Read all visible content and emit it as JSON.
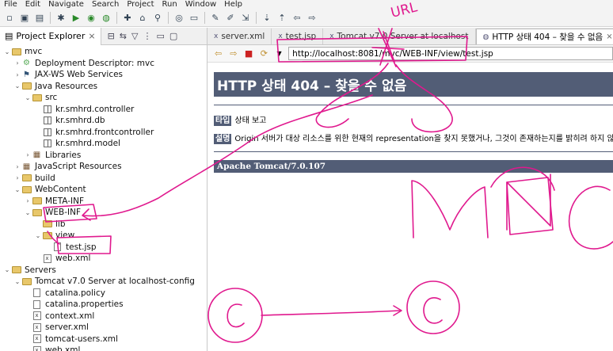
{
  "menu": [
    "File",
    "Edit",
    "Navigate",
    "Search",
    "Project",
    "Run",
    "Window",
    "Help"
  ],
  "explorer": {
    "title": "Project Explorer",
    "tree": [
      {
        "level": 0,
        "arrow": "open",
        "icon": "project",
        "label": "mvc"
      },
      {
        "level": 1,
        "arrow": "closed",
        "icon": "descriptor",
        "label": "Deployment Descriptor: mvc"
      },
      {
        "level": 1,
        "arrow": "closed",
        "icon": "webservice",
        "label": "JAX-WS Web Services"
      },
      {
        "level": 1,
        "arrow": "open",
        "icon": "java-resources",
        "label": "Java Resources"
      },
      {
        "level": 2,
        "arrow": "open",
        "icon": "src-folder",
        "label": "src"
      },
      {
        "level": 3,
        "arrow": "none",
        "icon": "package",
        "label": "kr.smhrd.controller"
      },
      {
        "level": 3,
        "arrow": "none",
        "icon": "package",
        "label": "kr.smhrd.db"
      },
      {
        "level": 3,
        "arrow": "none",
        "icon": "package",
        "label": "kr.smhrd.frontcontroller"
      },
      {
        "level": 3,
        "arrow": "none",
        "icon": "package",
        "label": "kr.smhrd.model"
      },
      {
        "level": 2,
        "arrow": "closed",
        "icon": "library",
        "label": "Libraries"
      },
      {
        "level": 1,
        "arrow": "closed",
        "icon": "js-resources",
        "label": "JavaScript Resources"
      },
      {
        "level": 1,
        "arrow": "closed",
        "icon": "folder",
        "label": "build"
      },
      {
        "level": 1,
        "arrow": "open",
        "icon": "folder",
        "label": "WebContent"
      },
      {
        "level": 2,
        "arrow": "closed",
        "icon": "folder",
        "label": "META-INF"
      },
      {
        "level": 2,
        "arrow": "open",
        "icon": "folder",
        "label": "WEB-INF"
      },
      {
        "level": 3,
        "arrow": "none",
        "icon": "folder",
        "label": "lib"
      },
      {
        "level": 3,
        "arrow": "open",
        "icon": "folder",
        "label": "view"
      },
      {
        "level": 4,
        "arrow": "none",
        "icon": "file",
        "label": "test.jsp"
      },
      {
        "level": 3,
        "arrow": "none",
        "icon": "xml-file",
        "label": "web.xml"
      },
      {
        "level": 0,
        "arrow": "open",
        "icon": "folder",
        "label": "Servers"
      },
      {
        "level": 1,
        "arrow": "open",
        "icon": "folder",
        "label": "Tomcat v7.0 Server at localhost-config"
      },
      {
        "level": 2,
        "arrow": "none",
        "icon": "file",
        "label": "catalina.policy"
      },
      {
        "level": 2,
        "arrow": "none",
        "icon": "file",
        "label": "catalina.properties"
      },
      {
        "level": 2,
        "arrow": "none",
        "icon": "xml-file",
        "label": "context.xml"
      },
      {
        "level": 2,
        "arrow": "none",
        "icon": "xml-file",
        "label": "server.xml"
      },
      {
        "level": 2,
        "arrow": "none",
        "icon": "xml-file",
        "label": "tomcat-users.xml"
      },
      {
        "level": 2,
        "arrow": "none",
        "icon": "xml-file",
        "label": "web.xml"
      }
    ]
  },
  "editor": {
    "tabs": [
      {
        "label": "server.xml",
        "active": false
      },
      {
        "label": "test.jsp",
        "active": false
      },
      {
        "label": "Tomcat v7.0 Server at localhost",
        "active": false
      },
      {
        "label": "HTTP 상태 404 – 찾을 수 없음",
        "active": true
      }
    ],
    "url": "http://localhost:8081/mvc/WEB-INF/view/test.jsp"
  },
  "error_page": {
    "heading": "HTTP 상태 404 – 찾을 수 없음",
    "type_label": "타입",
    "type_value": "상태 보고",
    "desc_label": "설명",
    "desc_value": "Origin 서버가 대상 리소스를 위한 현재의 representation을 찾지 못했거나, 그것이 존재하는지를 밝히려 하지 않습",
    "footer": "Apache Tomcat/7.0.107"
  },
  "annotations": {
    "handwritten": "URL",
    "color": "#e0198e"
  },
  "colors": {
    "tomcat_blue": "#525d76",
    "ink": "#e0198e"
  }
}
